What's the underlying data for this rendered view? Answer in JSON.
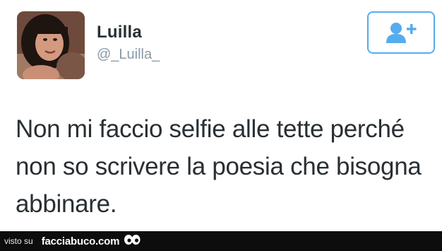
{
  "tweet": {
    "display_name": "Luilla",
    "handle": "@_Luilla_",
    "text": "Non mi faccio selfie alle tette perché non so scrivere la poesia che bisogna abbinare.",
    "follow_icon": "add-user-icon",
    "accent_color": "#55acee"
  },
  "footer": {
    "prefix": "visto su",
    "site": "facciabuco.com",
    "logo_icon": "eyes-icon"
  }
}
